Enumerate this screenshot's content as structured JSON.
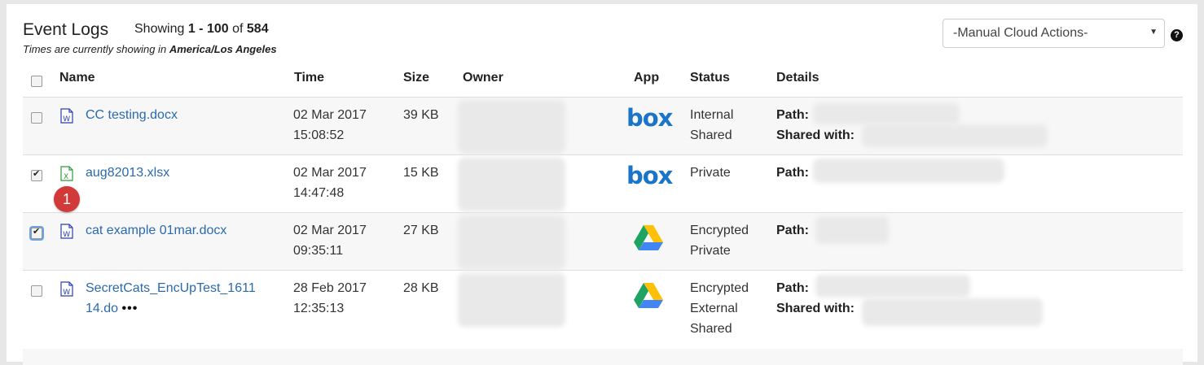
{
  "header": {
    "title": "Event Logs",
    "showing_prefix": "Showing",
    "range": "1 - 100",
    "of_word": "of",
    "total": "584",
    "timezone_prefix": "Times are currently showing in",
    "timezone": "America/Los Angeles"
  },
  "actions": {
    "selected": "-Manual Cloud Actions-",
    "help_icon": "?"
  },
  "columns": [
    "Name",
    "Time",
    "Size",
    "Owner",
    "App",
    "Status",
    "Details"
  ],
  "rows": [
    {
      "checked": false,
      "file_type": "word",
      "name": "CC testing.docx",
      "date": "02 Mar 2017",
      "time": "15:08:52",
      "size": "39 KB",
      "app": "box",
      "status": [
        "Internal",
        "Shared"
      ],
      "details": [
        "Path:",
        "Shared with:"
      ]
    },
    {
      "checked": true,
      "file_type": "excel",
      "name": "aug82013.xlsx",
      "date": "02 Mar 2017",
      "time": "14:47:48",
      "size": "15 KB",
      "app": "box",
      "status": [
        "Private"
      ],
      "details": [
        "Path:"
      ]
    },
    {
      "checked": true,
      "file_type": "word",
      "name": "cat example 01mar.docx",
      "date": "02 Mar 2017",
      "time": "09:35:11",
      "size": "27 KB",
      "app": "google-drive",
      "status": [
        "Encrypted",
        "Private"
      ],
      "details": [
        "Path:"
      ]
    },
    {
      "checked": false,
      "file_type": "word",
      "name_line1": "SecretCats_EncUpTest_1611",
      "name_line2": "14.do",
      "ellipsis": "•••",
      "date": "28 Feb 2017",
      "time": "12:35:13",
      "size": "28 KB",
      "app": "google-drive",
      "status": [
        "Encrypted",
        "External",
        "Shared"
      ],
      "details": [
        "Path:",
        "Shared with:"
      ]
    }
  ],
  "badge": {
    "number": "1"
  },
  "app_labels": {
    "box": "box"
  },
  "colors": {
    "link": "#2a6aad",
    "badge": "#d23a3a",
    "box": "#1a74c8"
  }
}
